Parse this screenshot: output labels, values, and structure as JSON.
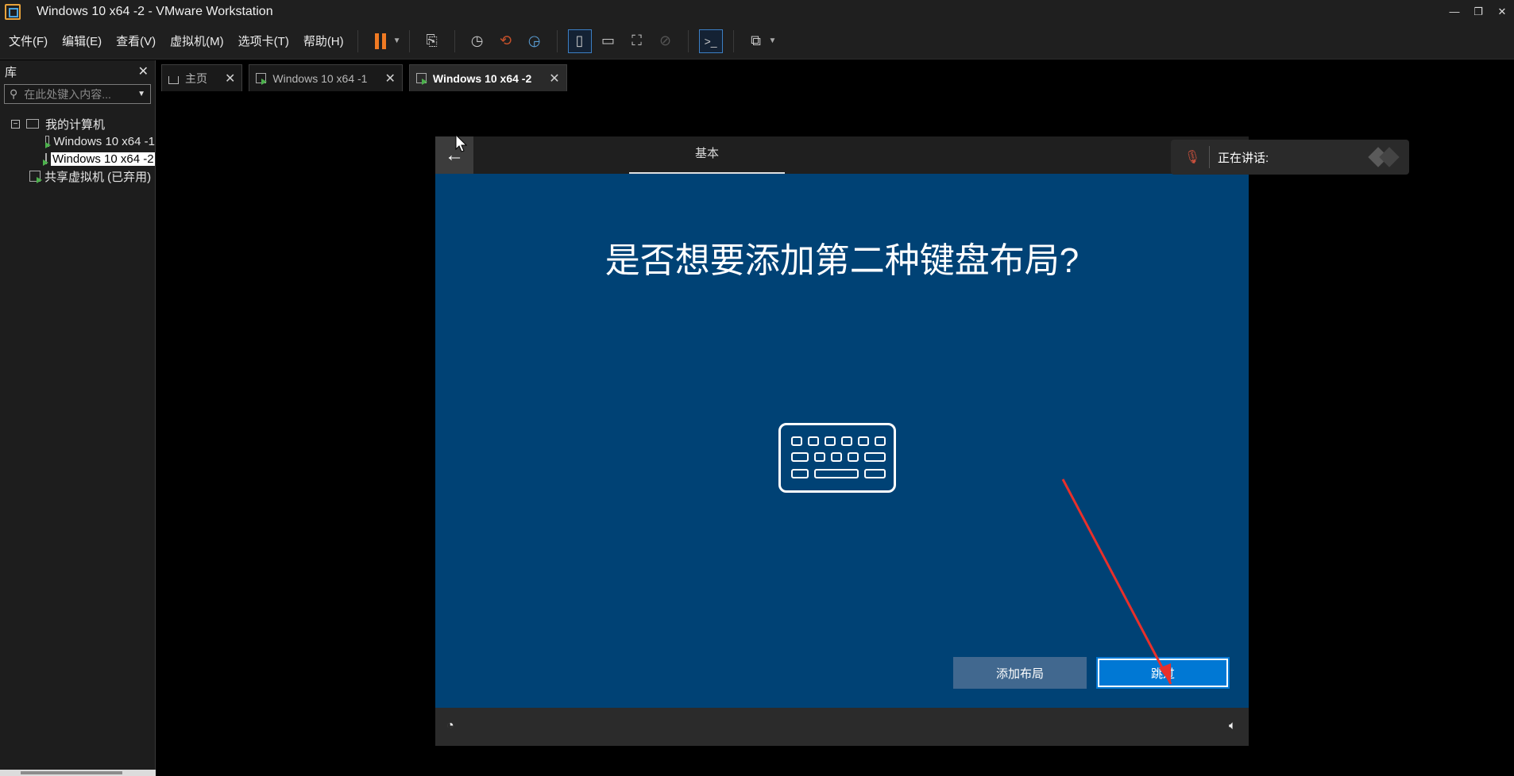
{
  "window": {
    "title": "Windows 10 x64 -2 - VMware Workstation"
  },
  "menu": {
    "items": [
      "文件(F)",
      "编辑(E)",
      "查看(V)",
      "虚拟机(M)",
      "选项卡(T)",
      "帮助(H)"
    ]
  },
  "library": {
    "title": "库",
    "search_placeholder": "在此处键入内容...",
    "tree": {
      "root": "我的计算机",
      "vm1": "Windows 10 x64 -1",
      "vm2": "Windows 10 x64 -2",
      "shared": "共享虚拟机 (已弃用)"
    }
  },
  "tabs": [
    {
      "label": "主页"
    },
    {
      "label": "Windows 10 x64 -1"
    },
    {
      "label": "Windows 10 x64 -2"
    }
  ],
  "oobe": {
    "step": "基本",
    "heading": "是否想要添加第二种键盘布局?",
    "add_button": "添加布局",
    "skip_button": "跳过"
  },
  "voice": {
    "status": "正在讲话:"
  },
  "colors": {
    "accent": "#0078d4",
    "oobe_bg": "#004275",
    "pause": "#f07a23",
    "annotation": "#e8302b"
  }
}
